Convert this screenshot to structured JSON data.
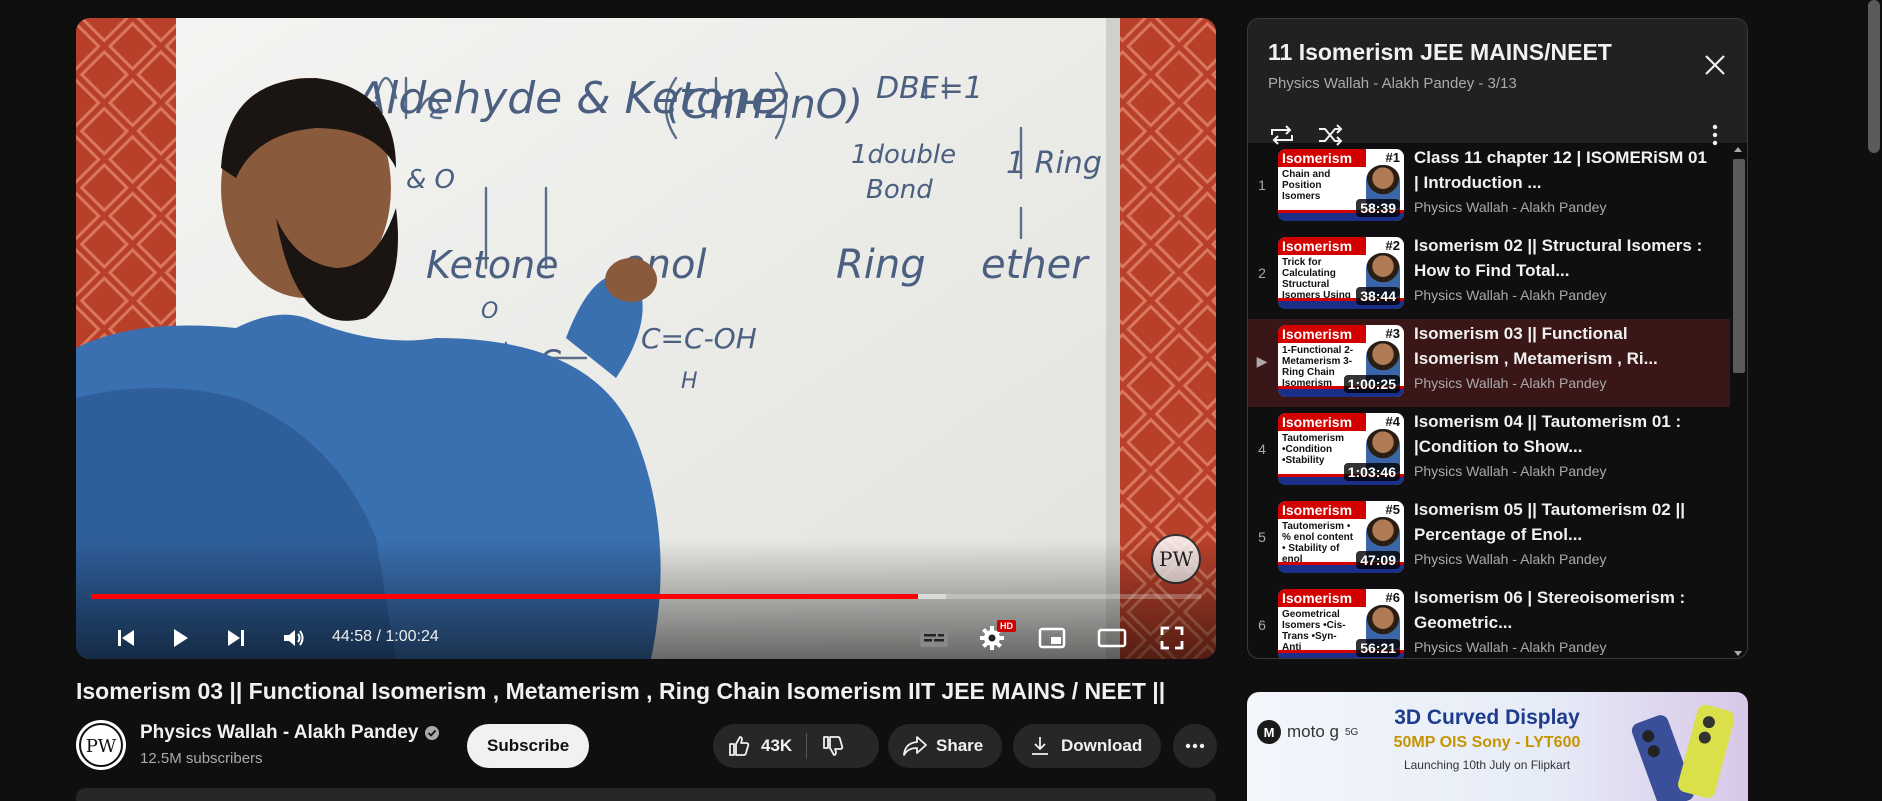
{
  "player": {
    "time_display": "44:58 / 1:00:24",
    "progress": 0.745,
    "buffered": 0.77,
    "hd_badge": "HD",
    "watermark": "PW"
  },
  "video": {
    "title": "Isomerism 03 || Functional Isomerism , Metamerism , Ring Chain Isomerism IIT JEE MAINS / NEET ||",
    "channel_name": "Physics Wallah - Alakh Pandey",
    "subscribers": "12.5M subscribers",
    "subscribe_label": "Subscribe",
    "likes": "43K",
    "share_label": "Share",
    "download_label": "Download"
  },
  "playlist": {
    "title": "11 Isomerism JEE MAINS/NEET",
    "subtitle": "Physics Wallah - Alakh Pandey - 3/13",
    "items": [
      {
        "index": "1",
        "title": "Class 11 chapter 12 | ISOMERiSM 01 | Introduction ...",
        "channel": "Physics Wallah - Alakh Pandey",
        "duration": "58:39",
        "thumb_head": "Isomerism",
        "thumb_num": "#1",
        "thumb_body": "Chain and Position Isomers",
        "active": false
      },
      {
        "index": "2",
        "title": "Isomerism 02 || Structural Isomers : How to Find Total...",
        "channel": "Physics Wallah - Alakh Pandey",
        "duration": "38:44",
        "thumb_head": "Isomerism",
        "thumb_num": "#2",
        "thumb_body": "Trick for Calculating Structural Isomers Using D.B.E",
        "active": false
      },
      {
        "index": "▶",
        "title": "Isomerism 03 || Functional Isomerism , Metamerism , Ri...",
        "channel": "Physics Wallah - Alakh Pandey",
        "duration": "1:00:25",
        "thumb_head": "Isomerism",
        "thumb_num": "#3",
        "thumb_body": "1-Functional 2-Metamerism 3-Ring Chain Isomerism",
        "active": true
      },
      {
        "index": "4",
        "title": "Isomerism 04 || Tautomerism 01 : |Condition to Show...",
        "channel": "Physics Wallah - Alakh Pandey",
        "duration": "1:03:46",
        "thumb_head": "Isomerism",
        "thumb_num": "#4",
        "thumb_body": "Tautomerism •Condition •Stability",
        "active": false
      },
      {
        "index": "5",
        "title": "Isomerism 05 || Tautomerism 02 || Percentage of Enol...",
        "channel": "Physics Wallah - Alakh Pandey",
        "duration": "47:09",
        "thumb_head": "Isomerism",
        "thumb_num": "#5",
        "thumb_body": "Tautomerism • % enol content • Stability of enol",
        "active": false
      },
      {
        "index": "6",
        "title": "Isomerism 06 | Stereoisomerism : Geometric...",
        "channel": "Physics Wallah - Alakh Pandey",
        "duration": "56:21",
        "thumb_head": "Isomerism",
        "thumb_num": "#6",
        "thumb_body": "Geometrical Isomers •Cis-Trans •Syn-Anti",
        "active": false
      }
    ]
  },
  "ad": {
    "brand": "moto g",
    "brand_suffix": "5G",
    "headline": "3D Curved Display",
    "subline": "50MP OIS Sony - LYT600",
    "note": "Launching 10th July on Flipkart"
  },
  "colors": {
    "accent_red": "#ff0000",
    "active_row": "#3a1616",
    "background": "#0f0f0f"
  },
  "icons": {
    "prev": "skip-previous-icon",
    "play": "play-icon",
    "next": "skip-next-icon",
    "volume": "volume-icon",
    "captions": "subtitles-icon",
    "settings": "gear-icon",
    "miniplayer": "miniplayer-icon",
    "theater": "theater-icon",
    "fullscreen": "fullscreen-icon",
    "like": "thumbs-up-icon",
    "dislike": "thumbs-down-icon",
    "share": "share-icon",
    "download": "download-icon",
    "more": "more-horizontal-icon",
    "close": "close-icon",
    "loop": "loop-icon",
    "shuffle": "shuffle-icon",
    "verified": "verified-icon"
  }
}
